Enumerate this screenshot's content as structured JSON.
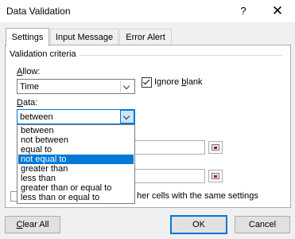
{
  "window": {
    "title": "Data Validation",
    "help_glyph": "?",
    "close_glyph": "✕"
  },
  "tabs": [
    {
      "label": "Settings"
    },
    {
      "label": "Input Message"
    },
    {
      "label": "Error Alert"
    }
  ],
  "validation_criteria": {
    "group_title": "Validation criteria",
    "allow_label_hotkey": "A",
    "allow_label_rest": "llow:",
    "allow_value": "Time",
    "ignore_blank_pre": "Ignore ",
    "ignore_blank_hotkey": "b",
    "ignore_blank_post": "lank",
    "ignore_blank_checked": true,
    "data_label_pre": "",
    "data_label_hotkey": "D",
    "data_label_rest": "ata:",
    "data_value": "between",
    "data_options": [
      "between",
      "not between",
      "equal to",
      "not equal to",
      "greater than",
      "less than",
      "greater than or equal to",
      "less than or equal to"
    ],
    "data_selected_index": 3
  },
  "apply_text": "her cells with the same settings",
  "buttons": {
    "clear_all_hotkey": "C",
    "clear_all_rest": "lear All",
    "ok": "OK",
    "cancel": "Cancel"
  },
  "colors": {
    "accent": "#0078d7",
    "selection": "#0078d7",
    "panel": "#ffffff",
    "dialog_bg": "#f0f0f0"
  }
}
